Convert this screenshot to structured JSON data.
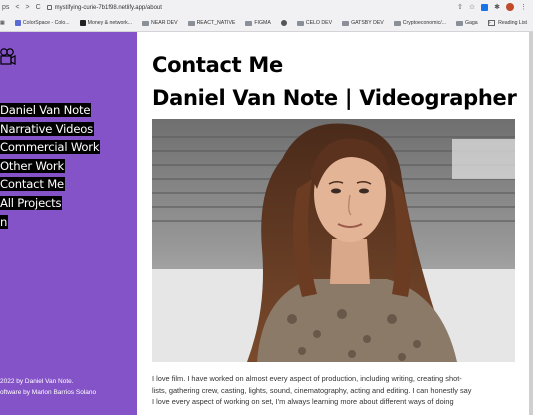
{
  "browser": {
    "nav_symbols": [
      "ps",
      "<",
      ">",
      "C"
    ],
    "url": "mystifying-curie-7b1f98.netlify.app/about",
    "bookmarks": [
      {
        "label": "ColorSpace - Colo...",
        "kind": "link",
        "color": "#5b6bd6"
      },
      {
        "label": "Money & network...",
        "kind": "link",
        "color": "#222222"
      },
      {
        "label": "NEAR DEV",
        "kind": "folder"
      },
      {
        "label": "REACT_NATIVE",
        "kind": "folder"
      },
      {
        "label": "FIGMA",
        "kind": "folder"
      },
      {
        "label": "",
        "kind": "link",
        "color": "#555555"
      },
      {
        "label": "CELO DEV",
        "kind": "folder"
      },
      {
        "label": "GATSBY DEV",
        "kind": "folder"
      },
      {
        "label": "Cryptoeconomic/...",
        "kind": "folder"
      },
      {
        "label": "Gaga",
        "kind": "folder"
      }
    ],
    "overflow_label": "»",
    "reading_list_label": "Reading List"
  },
  "sidebar": {
    "background": "#8553c8",
    "logo_icon": "video-camera-icon",
    "menu": [
      {
        "label": "Daniel Van Note",
        "name": "menu-item-home"
      },
      {
        "label": "Narrative Videos",
        "name": "menu-item-narrative-videos"
      },
      {
        "label": "Commercial Work",
        "name": "menu-item-commercial-work"
      },
      {
        "label": "Other Work",
        "name": "menu-item-other-work"
      },
      {
        "label": "Contact Me",
        "name": "menu-item-contact-me"
      },
      {
        "label": "All Projects",
        "name": "menu-item-all-projects"
      },
      {
        "label": "n",
        "name": "menu-item-extra"
      }
    ],
    "footer": {
      "copyright": "2022 by Daniel Van Note.",
      "credit": "oftware by Marlon Barrios Solano"
    }
  },
  "main": {
    "heading_contact": "Contact Me",
    "heading_name": "Daniel Van Note | Videographer",
    "photo_alt": "Portrait of a man with long brown hair",
    "bio_line1": "I love film. I have worked on almost every aspect of production, including writing, creating shot-",
    "bio_line2": "lists, gathering crew, casting, lights, sound, cinematography, acting and editing. I can honestly say",
    "bio_line3": "I love every aspect of working on set, I'm always learning more about different ways of doing"
  }
}
